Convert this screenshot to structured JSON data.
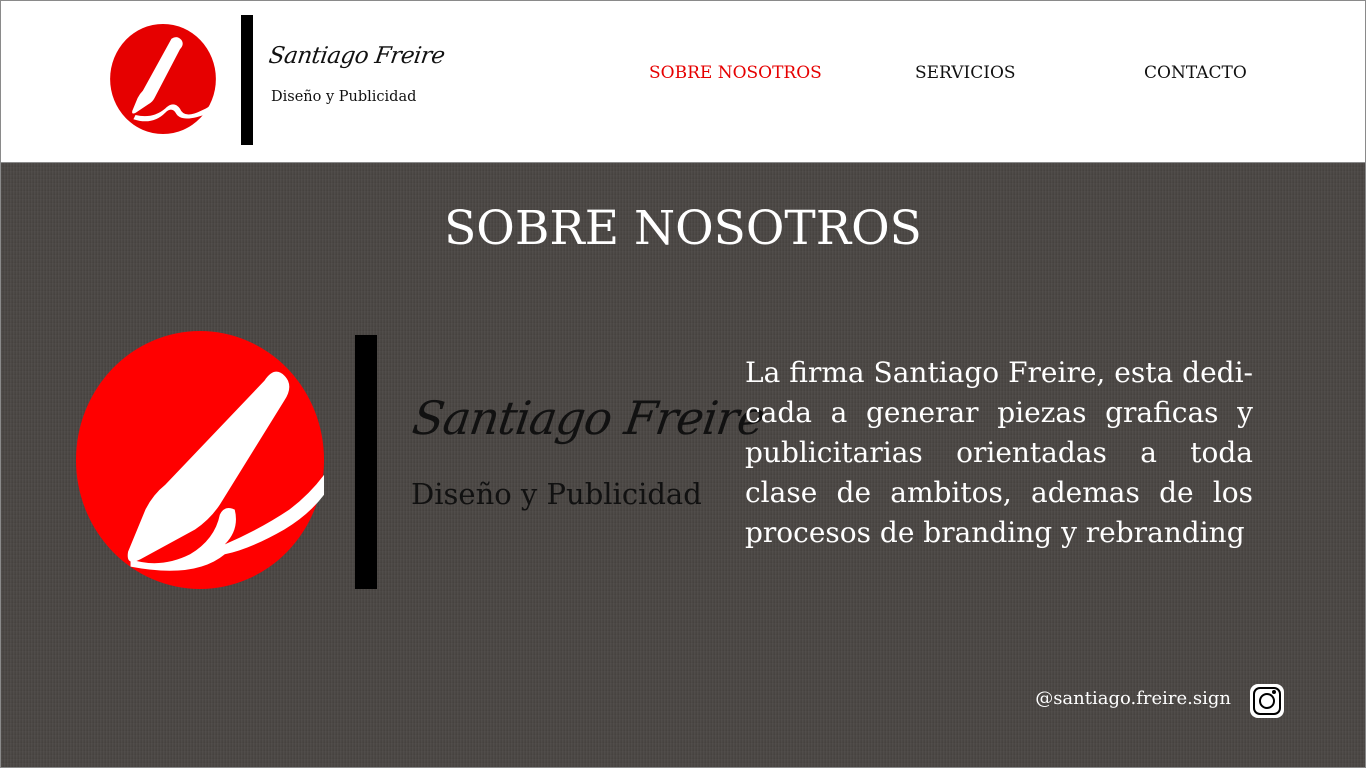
{
  "brand": {
    "script_name": "Santiago Freire",
    "tagline": "Diseño y Publicidad",
    "accent_color": "#e60000"
  },
  "nav": {
    "items": [
      {
        "label": "SOBRE NOSOTROS",
        "active": true
      },
      {
        "label": "SERVICIOS",
        "active": false
      },
      {
        "label": "CONTACTO",
        "active": false
      }
    ]
  },
  "main": {
    "title": "SOBRE NOSOTROS",
    "description": "La firma Santiago Freire, esta dedi-cada a generar piezas graficas y publicitarias orientadas a toda clase de ambitos, ademas de los procesos de branding y rebranding"
  },
  "social": {
    "instagram_handle": "@santiago.freire.sign",
    "icon": "instagram-icon"
  }
}
